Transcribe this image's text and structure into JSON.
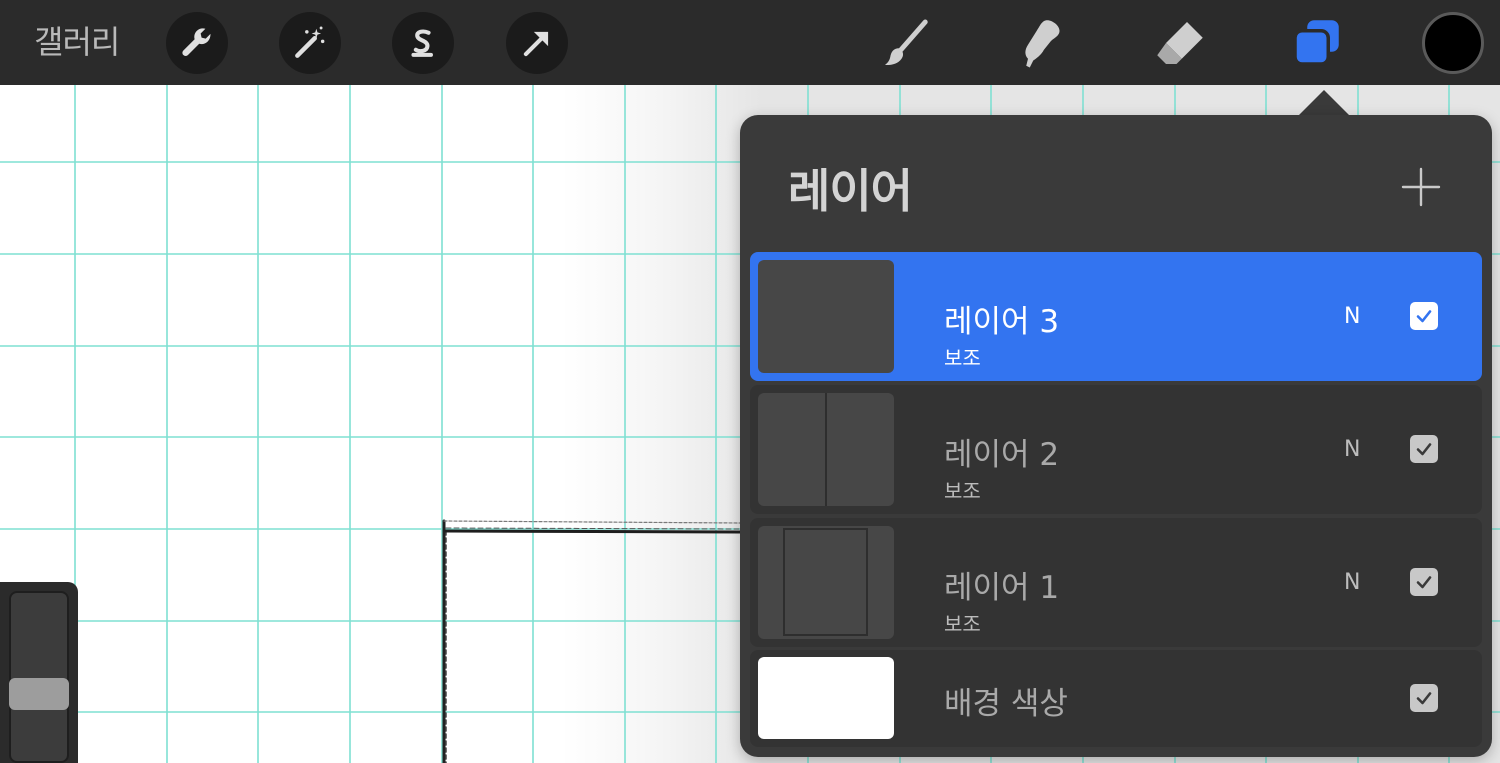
{
  "toolbar": {
    "gallery_label": "갤러리",
    "left_tools": [
      {
        "icon": "wrench-icon"
      },
      {
        "icon": "magic-wand-icon"
      },
      {
        "icon": "selection-s-icon"
      },
      {
        "icon": "transform-arrow-icon"
      }
    ],
    "right_tools": [
      {
        "icon": "brush-icon"
      },
      {
        "icon": "smudge-icon"
      },
      {
        "icon": "eraser-icon"
      },
      {
        "icon": "layers-icon"
      }
    ],
    "current_color": "#000000",
    "accent_color": "#3374f0"
  },
  "layers_panel": {
    "title": "레이어",
    "layers": [
      {
        "name": "레이어 3",
        "subtitle": "보조",
        "blend_mode": "N",
        "visible": true,
        "selected": true
      },
      {
        "name": "레이어 2",
        "subtitle": "보조",
        "blend_mode": "N",
        "visible": true,
        "selected": false
      },
      {
        "name": "레이어 1",
        "subtitle": "보조",
        "blend_mode": "N",
        "visible": true,
        "selected": false
      }
    ],
    "background": {
      "name": "배경 색상",
      "visible": true,
      "color": "#ffffff"
    }
  },
  "canvas": {
    "grid_color": "#7fe0d2"
  }
}
